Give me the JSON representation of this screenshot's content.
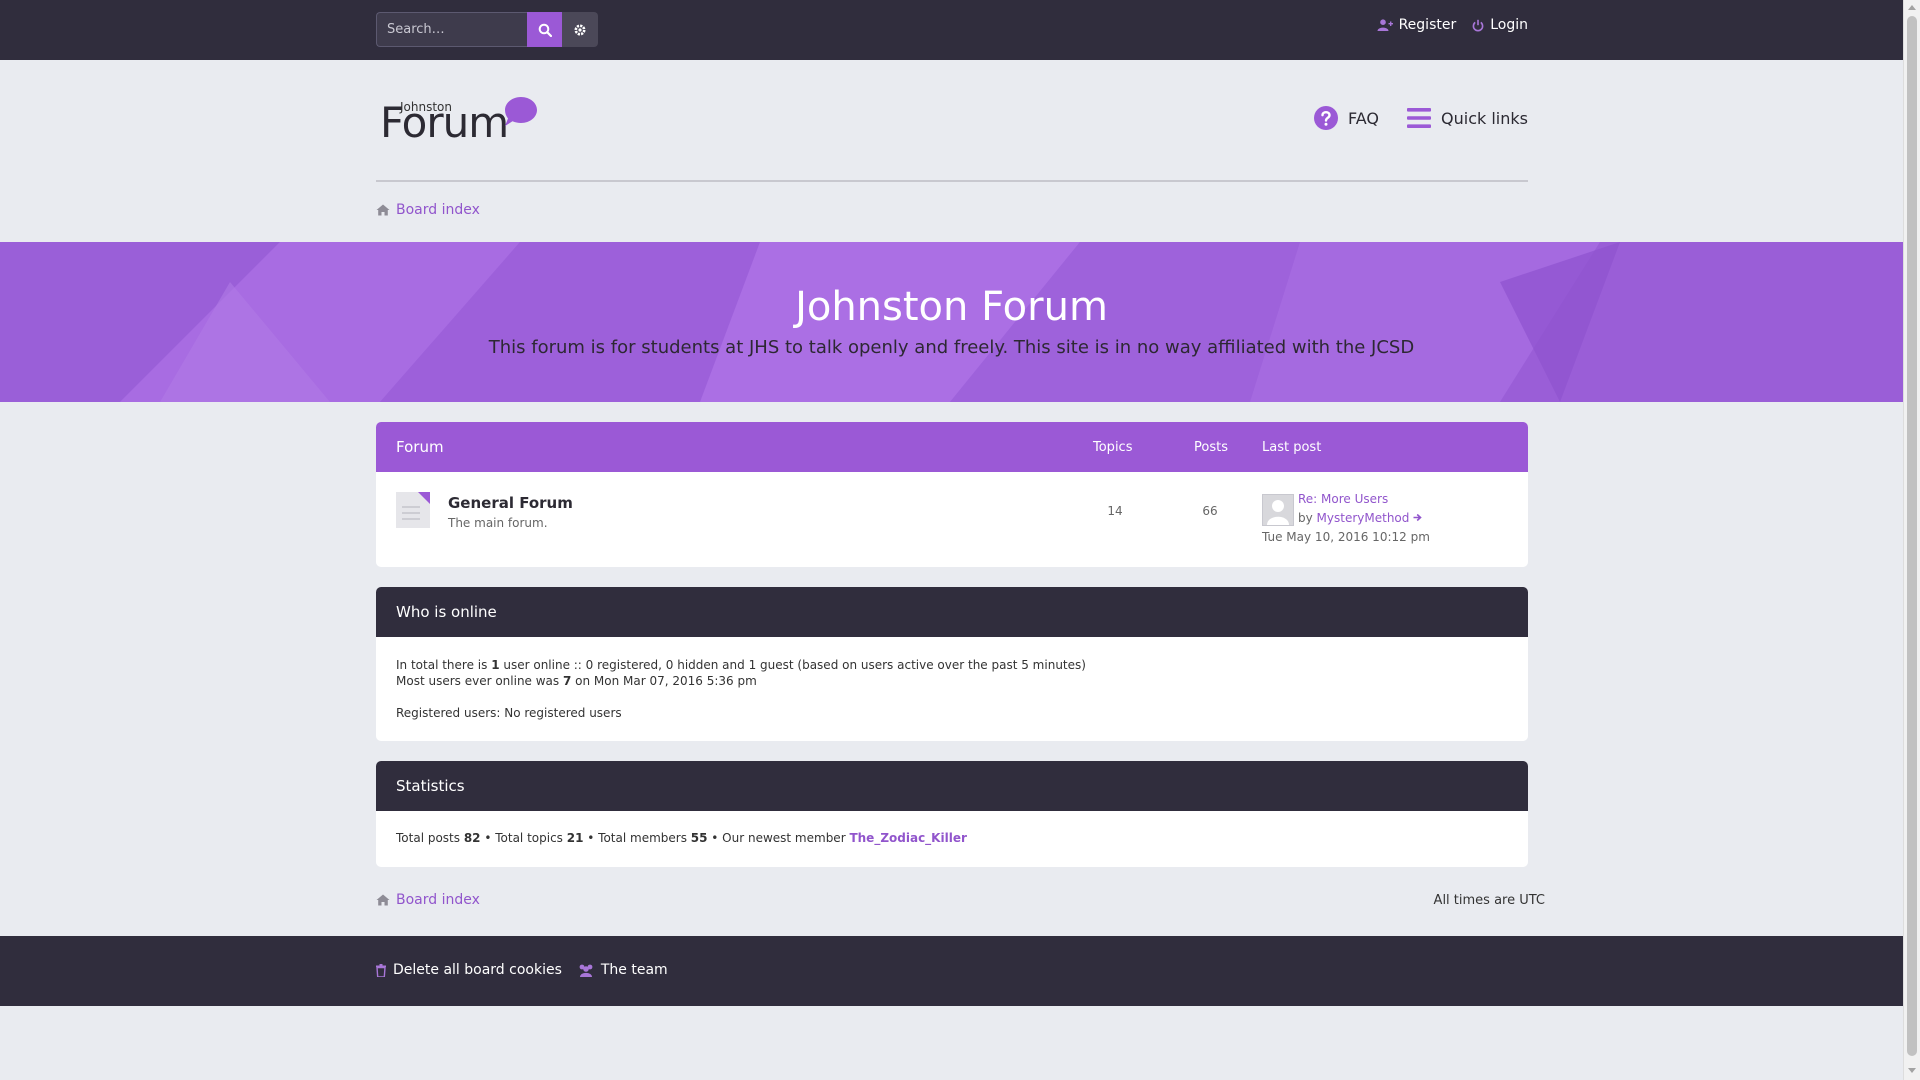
{
  "topbar": {
    "search_placeholder": "Search…",
    "register_label": "Register",
    "login_label": "Login"
  },
  "header": {
    "logo_small": "Johnston",
    "logo_big": "Forum",
    "faq_label": "FAQ",
    "quick_links_label": "Quick links"
  },
  "breadcrumb": {
    "board_index": "Board index"
  },
  "banner": {
    "title": "Johnston Forum",
    "description": "This forum is for students at JHS to talk openly and freely. This site is in no way affiliated with the JCSD"
  },
  "forum_table": {
    "headers": {
      "forum": "Forum",
      "topics": "Topics",
      "posts": "Posts",
      "last_post": "Last post"
    },
    "rows": [
      {
        "title": "General Forum",
        "description": "The main forum.",
        "topics": "14",
        "posts": "66",
        "last_post_title": "Re: More Users",
        "last_post_by_prefix": "by",
        "last_post_author": "MysteryMethod",
        "last_post_date": "Tue May 10, 2016 10:12 pm"
      }
    ]
  },
  "who_is_online": {
    "title": "Who is online",
    "line1_a": "In total there is ",
    "line1_count": "1",
    "line1_b": " user online :: 0 registered, 0 hidden and 1 guest (based on users active over the past 5 minutes)",
    "line2_a": "Most users ever online was ",
    "line2_count": "7",
    "line2_b": " on Mon Mar 07, 2016 5:36 pm",
    "registered": "Registered users: No registered users"
  },
  "statistics": {
    "title": "Statistics",
    "posts_label": "Total posts ",
    "posts_value": "82",
    "topics_label": " • Total topics ",
    "topics_value": "21",
    "members_label": " • Total members ",
    "members_value": "55",
    "newest_label": " • Our newest member ",
    "newest_member": "The_Zodiac_Killer"
  },
  "footer": {
    "times_note": "All times are UTC",
    "delete_cookies": "Delete all board cookies",
    "team": "The team"
  },
  "colors": {
    "accent": "#9b59d6",
    "dark": "#302d3d",
    "link": "#9155cc",
    "background": "#e9ebf0"
  }
}
